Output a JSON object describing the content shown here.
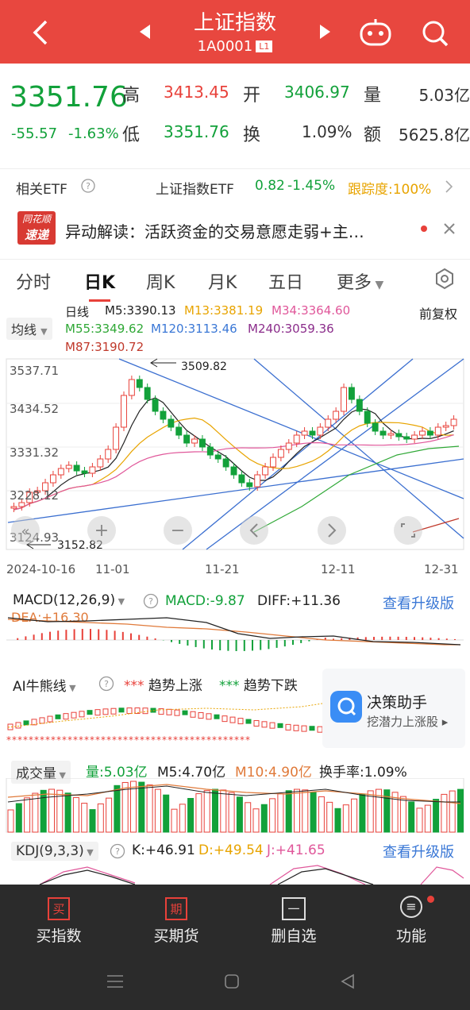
{
  "header": {
    "title": "上证指数",
    "code": "1A0001",
    "level": "L1"
  },
  "quote": {
    "price": "3351.76",
    "change": "-55.57",
    "change_pct": "-1.63%",
    "high_label": "高",
    "high": "3413.45",
    "open_label": "开",
    "open": "3406.97",
    "vol_label": "量",
    "vol": "5.03亿",
    "low_label": "低",
    "low": "3351.76",
    "turn_label": "换",
    "turn": "1.09%",
    "amt_label": "额",
    "amt": "5625.8亿"
  },
  "etf": {
    "label": "相关ETF",
    "name": "上证指数ETF",
    "price": "0.82",
    "pct": "-1.45%",
    "track": "跟踪度:100%"
  },
  "news": {
    "badge_top": "同花顺",
    "badge_bottom": "速递",
    "text": "异动解读：活跃资金的交易意愿走弱+主…"
  },
  "tabs": [
    "分时",
    "日K",
    "周K",
    "月K",
    "五日",
    "更多"
  ],
  "kline": {
    "ma_button": "均线",
    "period": "日线",
    "adjust": "前复权",
    "ma": [
      {
        "label": "M5:3390.13",
        "color": "#222222"
      },
      {
        "label": "M13:3381.19",
        "color": "#e8a400"
      },
      {
        "label": "M34:3364.60",
        "color": "#e0579a"
      },
      {
        "label": "M55:3349.62",
        "color": "#2fa836"
      },
      {
        "label": "M120:3113.46",
        "color": "#3b78d6"
      },
      {
        "label": "M240:3059.36",
        "color": "#8b2d8b"
      },
      {
        "label": "M87:3190.72",
        "color": "#c0392b"
      }
    ],
    "y_ticks": [
      "3537.71",
      "3434.52",
      "3331.32",
      "3228.12",
      "3124.93"
    ],
    "max_mark": "3509.82",
    "min_mark": "3152.82",
    "x_labels": [
      "2024-10-16",
      "11-01",
      "11-21",
      "12-11",
      "12-31"
    ]
  },
  "macd": {
    "selector": "MACD(12,26,9)",
    "macd": "MACD:-9.87",
    "diff": "DIFF:+11.36",
    "dea": "DEA:+16.30",
    "upgrade": "查看升级版"
  },
  "ai": {
    "selector": "AI牛熊线",
    "up": "趋势上涨",
    "down": "趋势下跌",
    "assistant_title": "决策助手",
    "assistant_sub": "挖潜力上涨股"
  },
  "volume": {
    "selector": "成交量",
    "vol": "量:5.03亿",
    "m5": "M5:4.70亿",
    "m10": "M10:4.90亿",
    "turnover": "换手率:1.09%"
  },
  "kdj": {
    "selector": "KDJ(9,3,3)",
    "k": "K:+46.91",
    "d": "D:+49.54",
    "j": "J:+41.65",
    "upgrade": "查看升级版"
  },
  "bottom_nav": [
    {
      "label": "买指数",
      "icon": "买"
    },
    {
      "label": "买期货",
      "icon": "期"
    },
    {
      "label": "删自选",
      "icon": "一"
    },
    {
      "label": "功能",
      "icon": "≡"
    }
  ],
  "colors": {
    "up": "#e8413a",
    "down": "#12a13a",
    "header": "#e8473f"
  }
}
